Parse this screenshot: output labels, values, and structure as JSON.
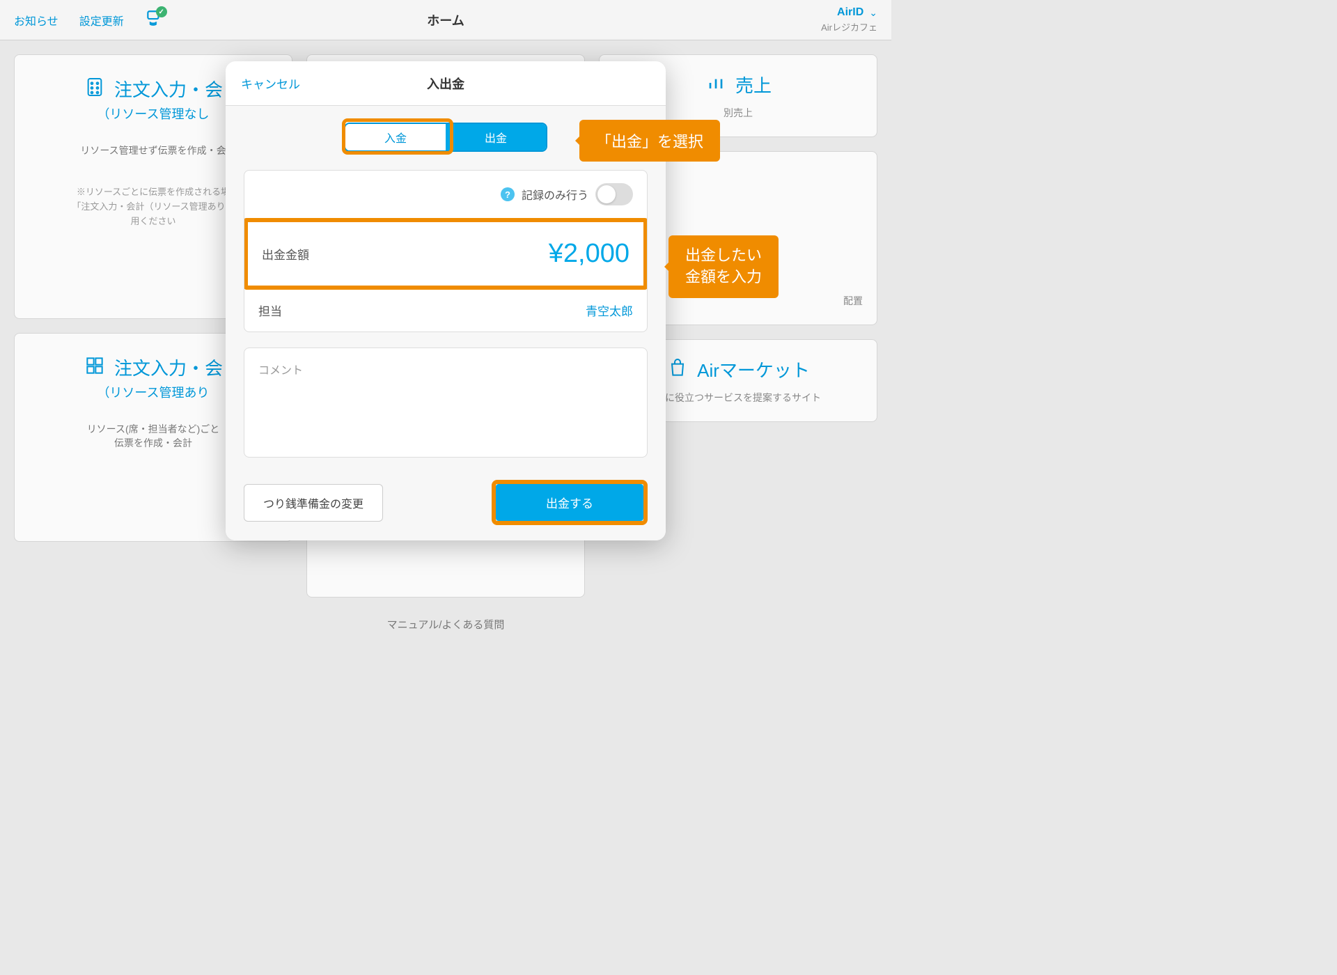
{
  "topnav": {
    "notice": "お知らせ",
    "settings_update": "設定更新",
    "title": "ホーム",
    "airid": "AirID",
    "store": "Airレジカフェ"
  },
  "cards": {
    "order1_title": "注文入力・会",
    "order1_sub": "（リソース管理なし",
    "order1_desc": "リソース管理せず伝票を作成・会",
    "order1_note1": "※リソースごとに伝票を作成される場",
    "order1_note2": "「注文入力・会計（リソース管理あり）",
    "order1_note3": "用ください",
    "order2_title": "注文入力・会",
    "order2_sub": "（リソース管理あり",
    "order2_desc1": "リソース(席・担当者など)ごと",
    "order2_desc2": "伝票を作成・会計",
    "sales_title": "売上",
    "sales_sub": "別売上",
    "market_title": "Airマーケット",
    "market_sub": "務に役立つサービスを提案するサイト",
    "layout_sub": "配置",
    "manual": "マニュアル/よくある質問"
  },
  "modal": {
    "cancel": "キャンセル",
    "title": "入出金",
    "seg_in": "入金",
    "seg_out": "出金",
    "record_only": "記録のみ行う",
    "amount_label": "出金金額",
    "amount_value": "¥2,000",
    "staff_label": "担当",
    "staff_name": "青空太郎",
    "comment": "コメント",
    "change_reserve": "つり銭準備金の変更",
    "submit": "出金する"
  },
  "callouts": {
    "select_out": "「出金」を選択",
    "enter_amount": "出金したい\n金額を入力"
  }
}
